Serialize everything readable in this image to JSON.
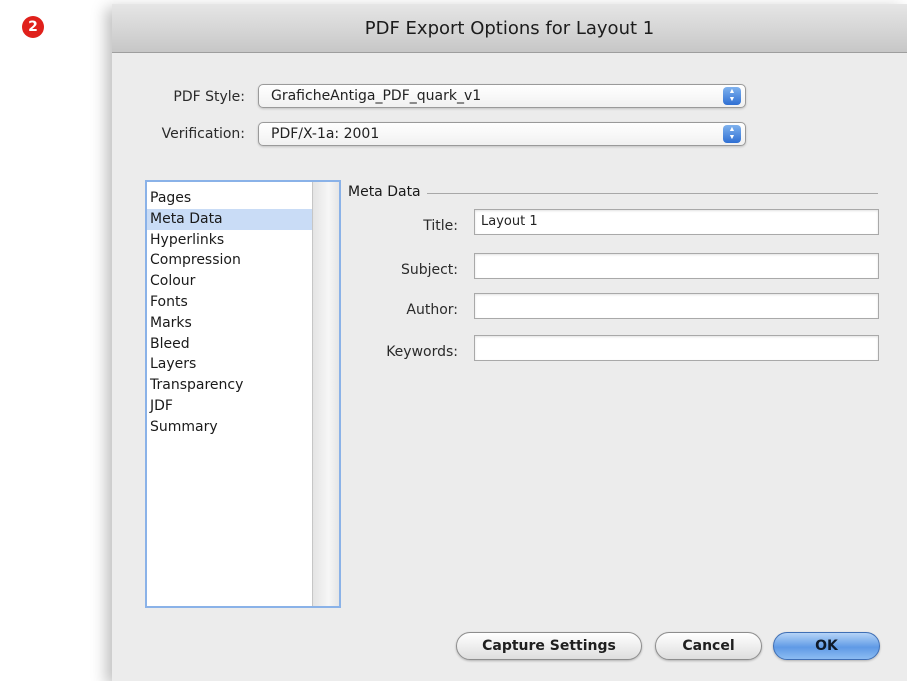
{
  "step_badge": "2",
  "dialog": {
    "title": "PDF Export Options for Layout 1"
  },
  "pdf_style": {
    "label": "PDF Style:",
    "value": "GraficheAntiga_PDF_quark_v1"
  },
  "verification": {
    "label": "Verification:",
    "value": "PDF/X-1a: 2001"
  },
  "categories": {
    "items": [
      "Pages",
      "Meta Data",
      "Hyperlinks",
      "Compression",
      "Colour",
      "Fonts",
      "Marks",
      "Bleed",
      "Layers",
      "Transparency",
      "JDF",
      "Summary"
    ],
    "selected": "Meta Data"
  },
  "meta_data": {
    "group_title": "Meta Data",
    "title_label": "Title:",
    "title_value": "Layout 1",
    "subject_label": "Subject:",
    "subject_value": "",
    "author_label": "Author:",
    "author_value": "",
    "keywords_label": "Keywords:",
    "keywords_value": ""
  },
  "buttons": {
    "capture_settings": "Capture Settings",
    "cancel": "Cancel",
    "ok": "OK"
  },
  "colors": {
    "badge": "#e0201b",
    "selection": "#c9dcf6",
    "default_button": "#5f9ae6"
  }
}
